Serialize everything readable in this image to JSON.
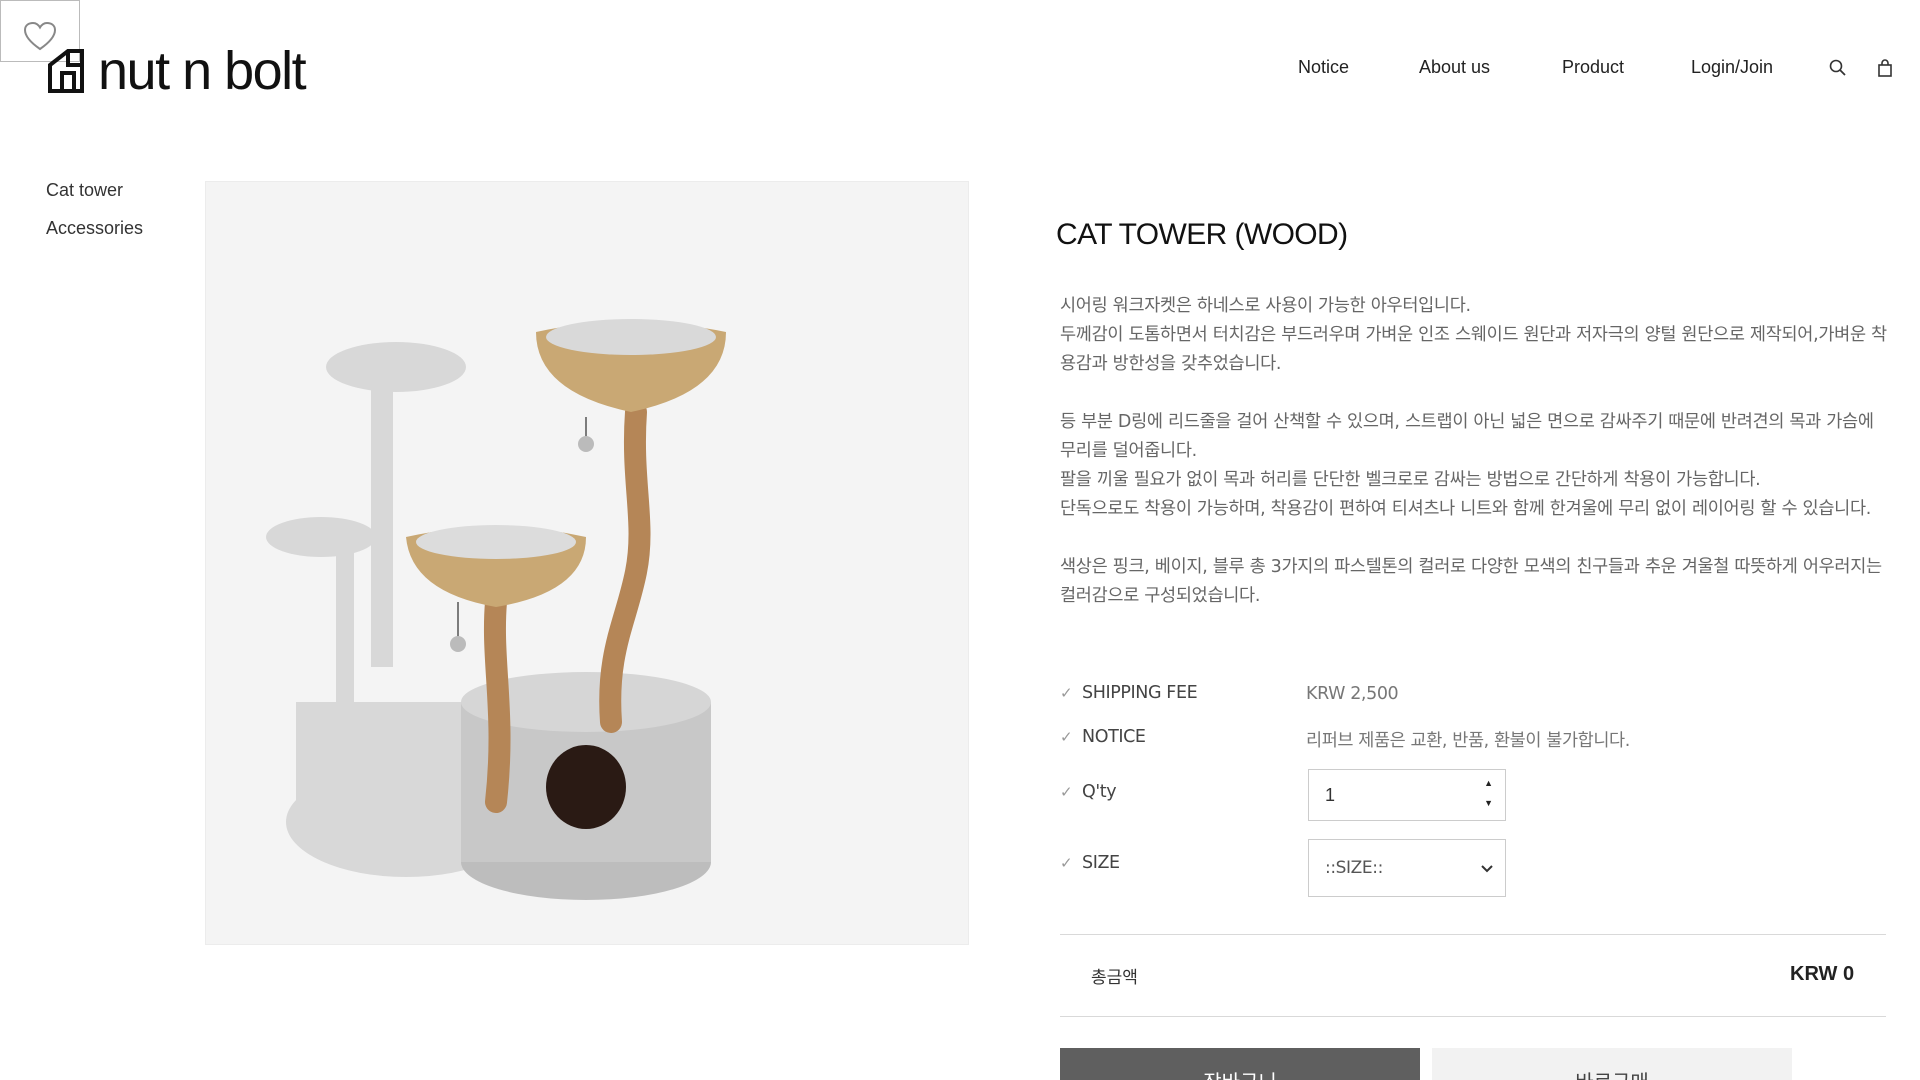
{
  "header": {
    "logo_text": "nut n bolt",
    "nav": [
      "Notice",
      "About us",
      "Product",
      "Login/Join"
    ],
    "icons": [
      "search-icon",
      "shopping-bag-icon"
    ]
  },
  "sidebar": {
    "items": [
      {
        "label": "Cat tower"
      },
      {
        "label": "Accessories"
      }
    ]
  },
  "product": {
    "title": "CAT TOWER (WOOD)",
    "description": [
      "시어링 워크자켓은 하네스로 사용이 가능한 아우터입니다.",
      "두께감이 도톰하면서 터치감은 부드러우며 가벼운 인조 스웨이드 원단과 저자극의 양털 원단으로 제작되어,가벼운 착용감과 방한성을 갖추었습니다.",
      "",
      "등 부분 D링에 리드줄을 걸어 산책할 수 있으며, 스트랩이 아닌 넓은 면으로 감싸주기 때문에 반려견의 목과 가슴에 무리를 덜어줍니다.",
      "팔을 끼울 필요가 없이 목과 허리를 단단한 벨크로로 감싸는 방법으로 간단하게 착용이 가능합니다.",
      "단독으로도 착용이 가능하며, 착용감이 편하여 티셔츠나 니트와 함께 한겨울에 무리 없이 레이어링 할 수 있습니다.",
      "",
      "색상은 핑크, 베이지, 블루 총 3가지의 파스텔톤의 컬러로 다양한 모색의 친구들과 추운 겨울철 따뜻하게 어우러지는 컬러감으로 구성되었습니다."
    ],
    "shipping_label": "SHIPPING FEE",
    "shipping_value": "KRW 2,500",
    "notice_label": "NOTICE",
    "notice_value": "리퍼브 제품은 교환, 반품, 환불이 불가합니다.",
    "qty_label": "Q'ty",
    "qty_value": "1",
    "size_label": "SIZE",
    "size_selected": "::SIZE::",
    "total_label": "총금액",
    "total_value": "KRW 0",
    "cart_button": "장바구니",
    "buy_button": "바로구매"
  },
  "colors": {
    "cart_button_bg": "#5f5f5f",
    "buy_button_bg": "#f2f2f2",
    "image_bg": "#f4f4f4"
  }
}
